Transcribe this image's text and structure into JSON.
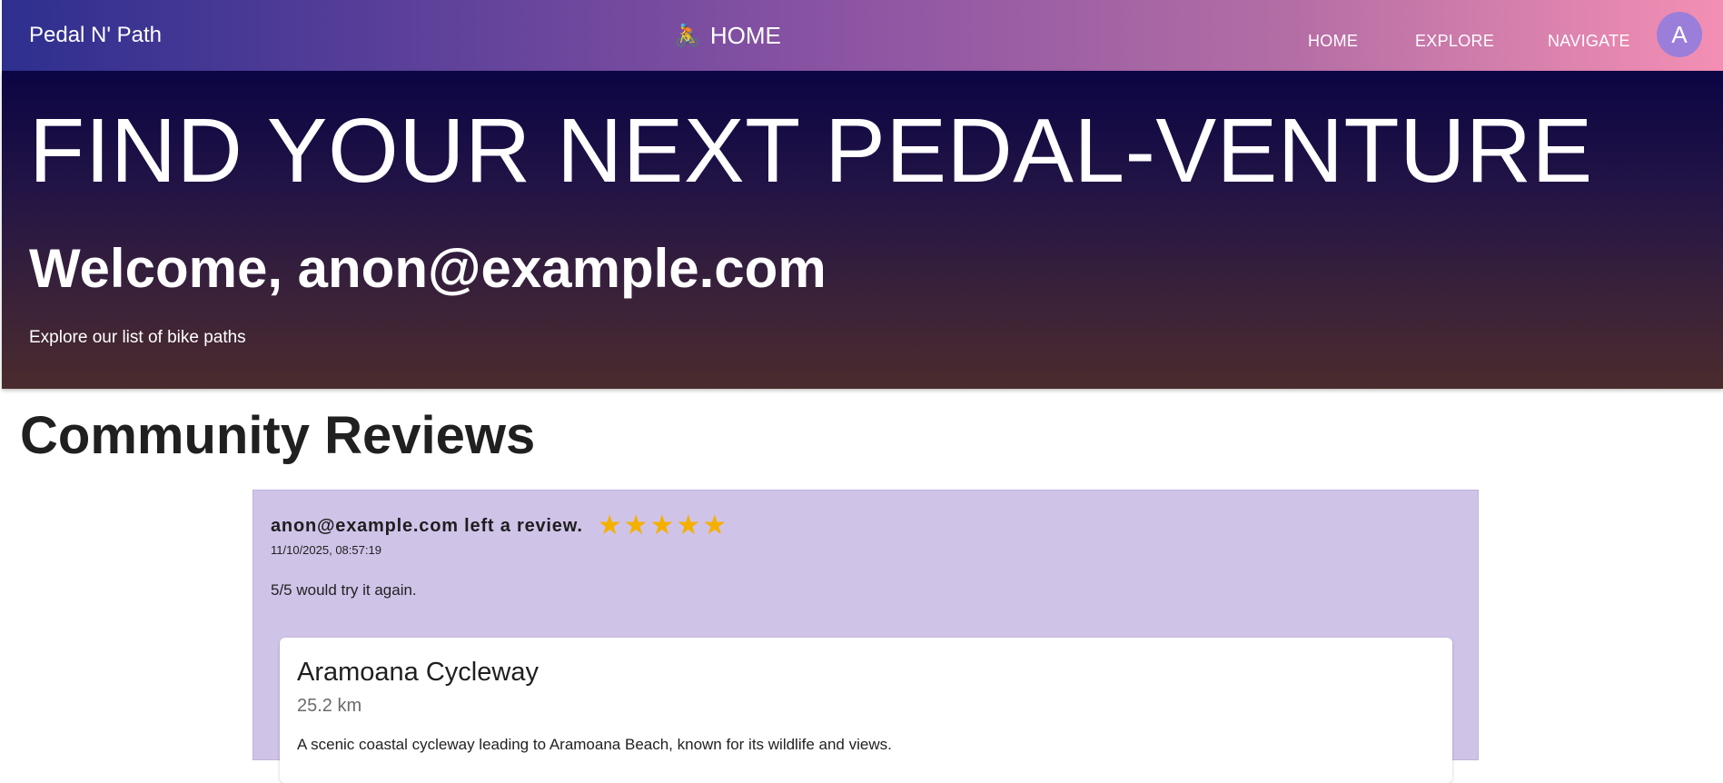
{
  "appbar": {
    "brand": "Pedal N' Path",
    "center_icon": "🚴",
    "center_label": "HOME",
    "nav": {
      "home": "HOME",
      "explore": "EXPLORE",
      "navigate": "NAVIGATE"
    },
    "avatar_letter": "A"
  },
  "hero": {
    "title": "FIND YOUR NEXT PEDAL-VENTURE",
    "welcome": "Welcome, anon@example.com",
    "subtitle": "Explore our list of bike paths"
  },
  "reviews_section": {
    "title": "Community Reviews",
    "reviews": [
      {
        "author_line": "anon@example.com left a review.",
        "rating": 5,
        "rating_max": 5,
        "star_glyph": "★",
        "timestamp": "11/10/2025, 08:57:19",
        "text": "5/5 would try it again.",
        "path": {
          "name": "Aramoana Cycleway",
          "distance": "25.2 km",
          "description": "A scenic coastal cycleway leading to Aramoana Beach, known for its wildlife and views."
        }
      }
    ]
  },
  "colors": {
    "star": "#f4b000",
    "review_card_bg": "#d0c3e8",
    "avatar_bg": "#9b7ed9"
  }
}
